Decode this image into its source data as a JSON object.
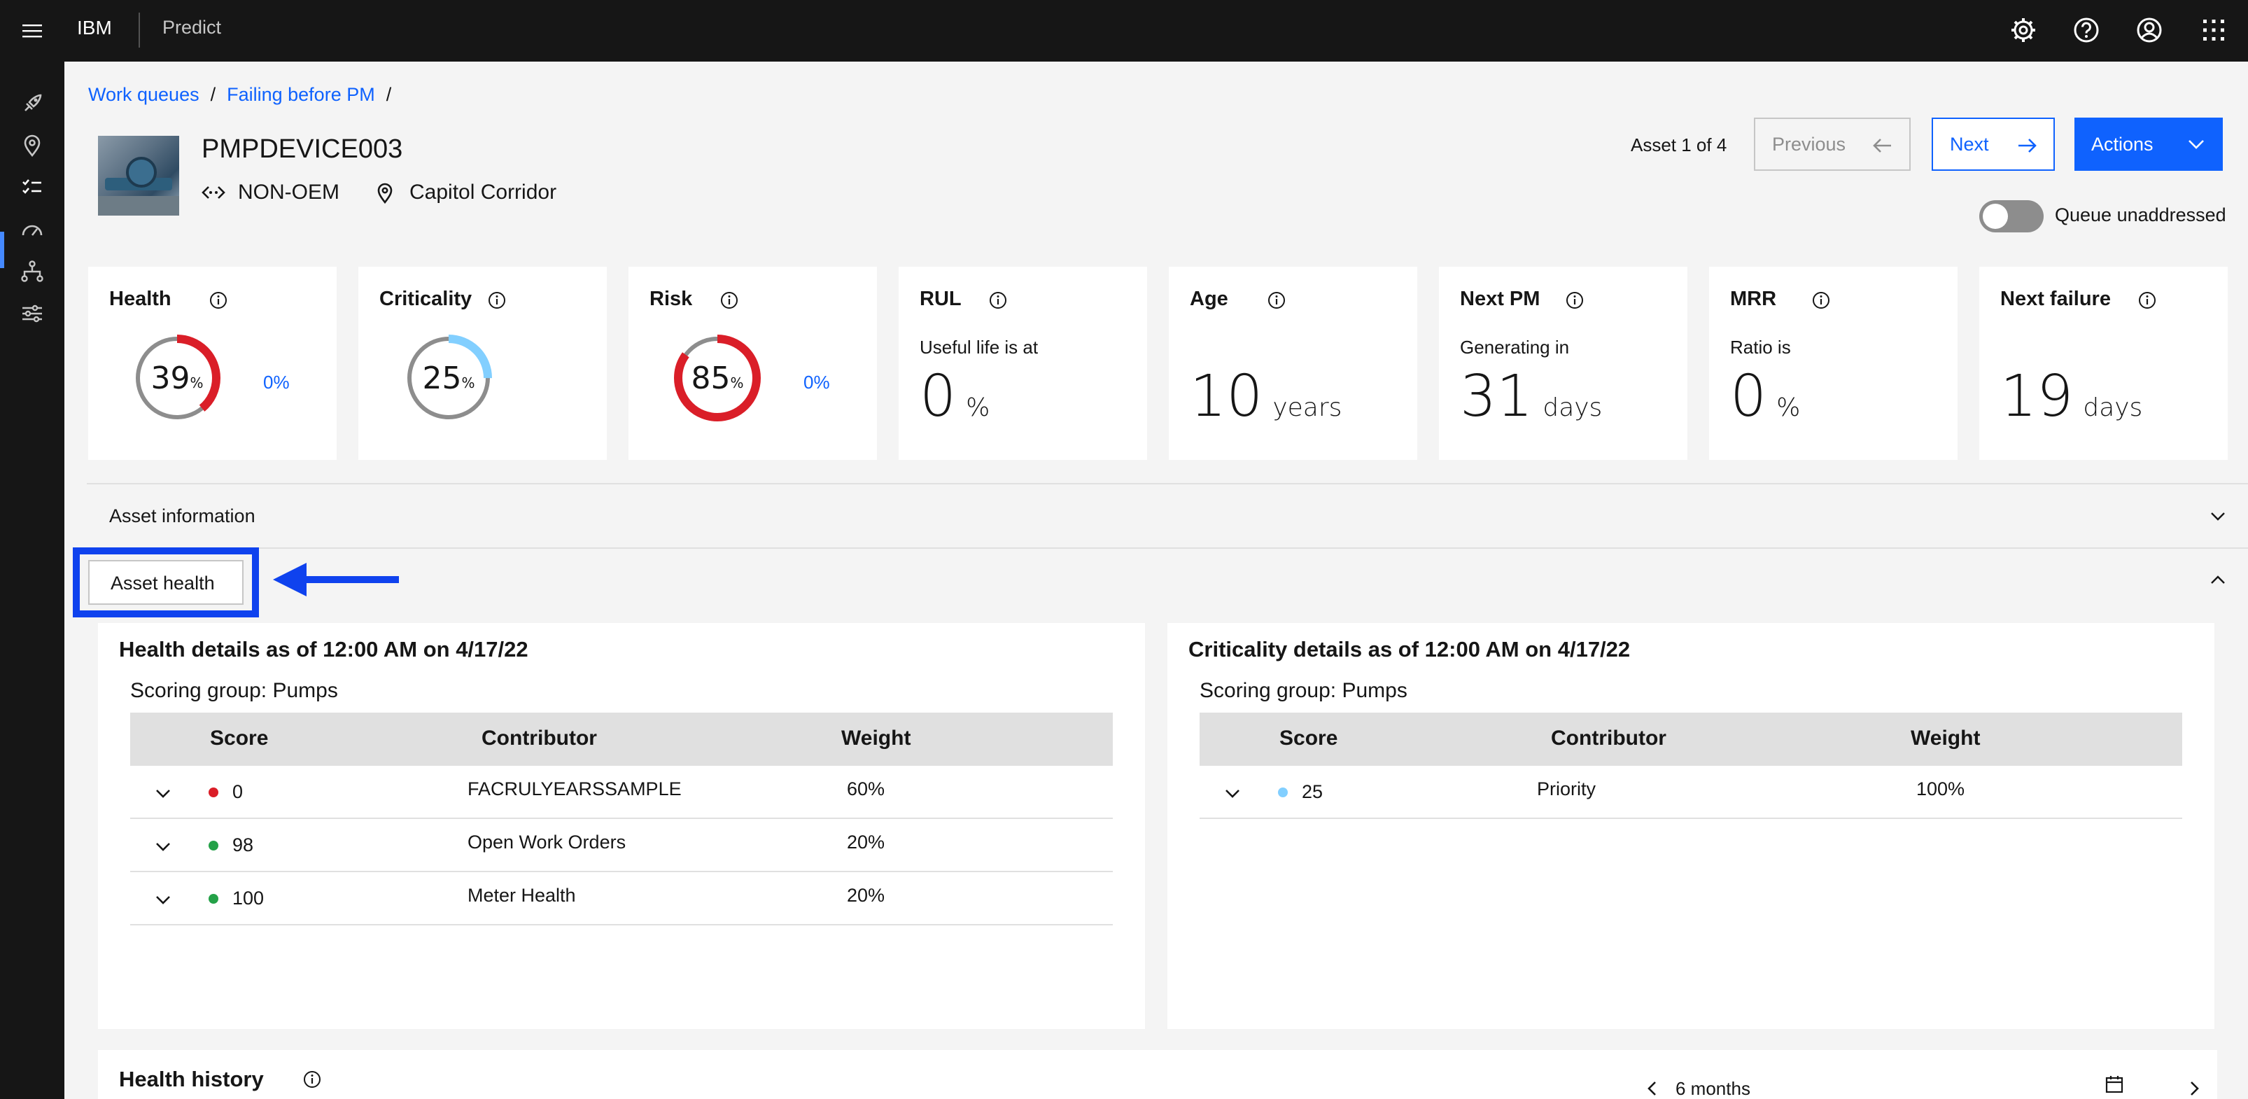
{
  "topbar": {
    "brand": "IBM",
    "product": "Predict",
    "icons": [
      "settings-icon",
      "help-icon",
      "user-profile-icon",
      "app-switcher-icon"
    ]
  },
  "leftnav": {
    "icons": [
      "rocket-icon",
      "location-icon",
      "checklist-icon",
      "dashboard-icon",
      "hierarchy-icon",
      "settings-adjust-icon"
    ],
    "active_index": 2
  },
  "breadcrumb": {
    "items": [
      "Work queues",
      "Failing before PM"
    ],
    "separator": "/"
  },
  "asset": {
    "id": "PMPDEVICE003",
    "type": "NON-OEM",
    "location": "Capitol Corridor"
  },
  "pager": {
    "text": "Asset 1 of 4",
    "previous_label": "Previous",
    "next_label": "Next",
    "actions_label": "Actions"
  },
  "toggle": {
    "label": "Queue unaddressed",
    "on": false
  },
  "tiles": {
    "health": {
      "title": "Health",
      "value": "39",
      "unit": "%",
      "trend": "0%",
      "fraction": 0.39,
      "color": "#da1e28"
    },
    "criticality": {
      "title": "Criticality",
      "value": "25",
      "unit": "%",
      "fraction": 0.25,
      "color": "#82cfff"
    },
    "risk": {
      "title": "Risk",
      "value": "85",
      "unit": "%",
      "trend": "0%",
      "fraction": 0.85,
      "color": "#da1e28"
    },
    "rul": {
      "title": "RUL",
      "sub": "Useful life is at",
      "value": "0",
      "unit": "%"
    },
    "age": {
      "title": "Age",
      "value": "10",
      "unit": "years"
    },
    "next_pm": {
      "title": "Next PM",
      "sub": "Generating in",
      "value": "31",
      "unit": "days"
    },
    "mrr": {
      "title": "MRR",
      "sub": "Ratio is",
      "value": "0",
      "unit": "%"
    },
    "next_failure": {
      "title": "Next failure",
      "value": "19",
      "unit": "days"
    }
  },
  "accordion": {
    "asset_information": "Asset information",
    "asset_health": "Asset health"
  },
  "health_panel": {
    "title": "Health details as of 12:00 AM on 4/17/22",
    "scoring_group": "Scoring group:  Pumps",
    "headers": {
      "score": "Score",
      "contributor": "Contributor",
      "weight": "Weight"
    },
    "rows": [
      {
        "score": "0",
        "dot": "#da1e28",
        "contributor": "FACRULYEARSSAMPLE",
        "weight": "60%"
      },
      {
        "score": "98",
        "dot": "#24a148",
        "contributor": "Open Work Orders",
        "weight": "20%"
      },
      {
        "score": "100",
        "dot": "#24a148",
        "contributor": "Meter Health",
        "weight": "20%"
      }
    ]
  },
  "criticality_panel": {
    "title": "Criticality details as of 12:00 AM on 4/17/22",
    "scoring_group": "Scoring group:  Pumps",
    "headers": {
      "score": "Score",
      "contributor": "Contributor",
      "weight": "Weight"
    },
    "rows": [
      {
        "score": "25",
        "dot": "#82cfff",
        "contributor": "Priority",
        "weight": "100%"
      }
    ]
  },
  "history": {
    "title": "Health history",
    "range": "6 months"
  }
}
